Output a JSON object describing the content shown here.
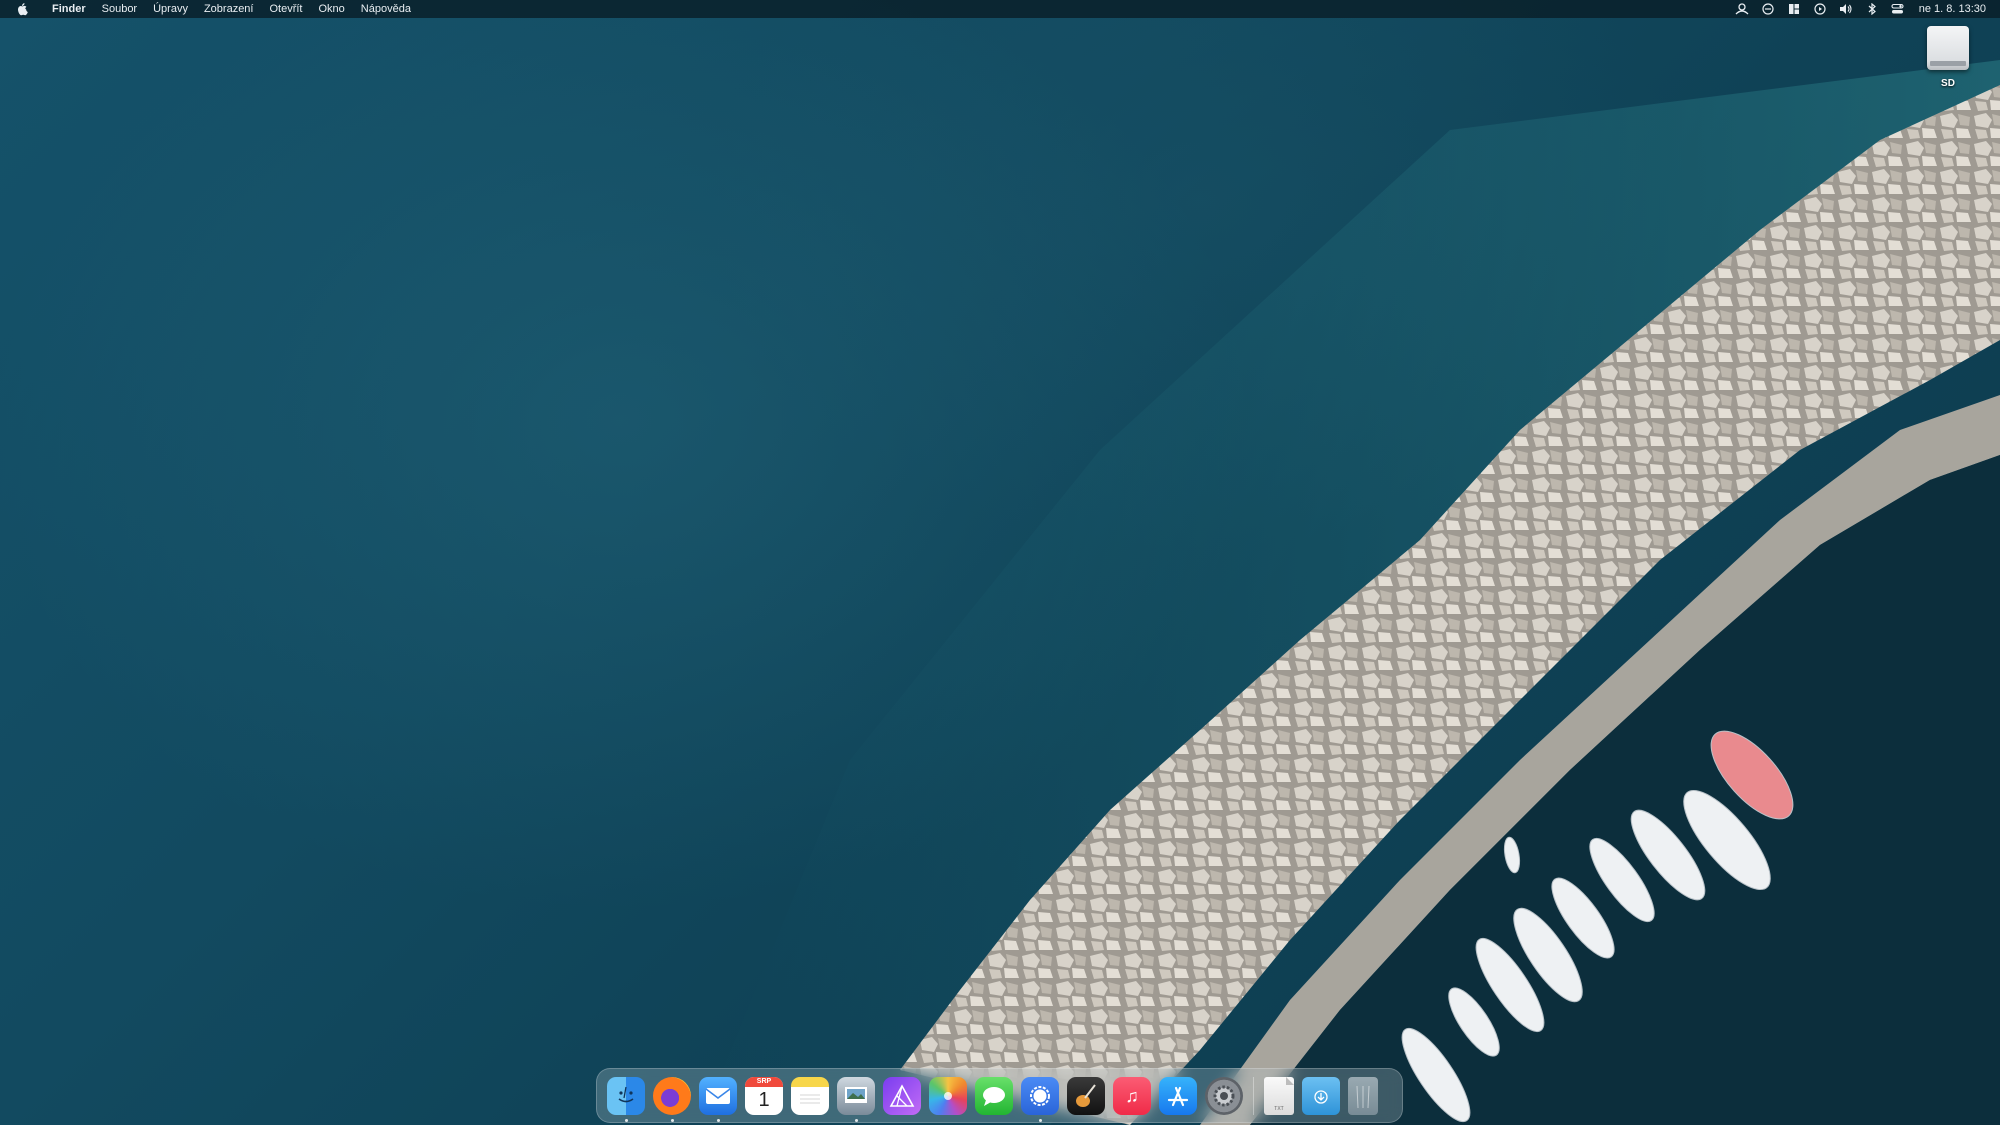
{
  "menubar": {
    "app_name": "Finder",
    "menus": [
      "Soubor",
      "Úpravy",
      "Zobrazení",
      "Otevřít",
      "Okno",
      "Nápověda"
    ],
    "status_icons": [
      "astronaut-icon",
      "minus-circle-icon",
      "window-layout-icon",
      "play-circle-icon",
      "volume-icon",
      "bluetooth-icon",
      "control-center-icon"
    ],
    "clock": "ne 1. 8.  13:30"
  },
  "desktop": {
    "drive_label": "SD"
  },
  "dock": {
    "apps": [
      {
        "name": "Finder",
        "icon": "finder-icon",
        "running": true
      },
      {
        "name": "Firefox",
        "icon": "firefox-icon",
        "running": true
      },
      {
        "name": "Mail",
        "icon": "mail-icon",
        "running": true
      },
      {
        "name": "Kalendář",
        "icon": "calendar-icon",
        "running": false,
        "month": "SRP",
        "day": "1"
      },
      {
        "name": "Poznámky",
        "icon": "notes-icon",
        "running": false
      },
      {
        "name": "Náhled",
        "icon": "preview-icon",
        "running": true
      },
      {
        "name": "Affinity",
        "icon": "affinity-icon",
        "running": false
      },
      {
        "name": "Fotky",
        "icon": "photos-icon",
        "running": false
      },
      {
        "name": "Zprávy",
        "icon": "messages-icon",
        "running": false
      },
      {
        "name": "Signal",
        "icon": "signal-icon",
        "running": true
      },
      {
        "name": "GarageBand",
        "icon": "garageband-icon",
        "running": false
      },
      {
        "name": "Hudba",
        "icon": "music-icon",
        "running": false
      },
      {
        "name": "App Store",
        "icon": "appstore-icon",
        "running": false
      },
      {
        "name": "Nastavení",
        "icon": "settings-icon",
        "running": false
      }
    ],
    "others": [
      {
        "icon": "text-document-icon",
        "badge": "TXT"
      },
      {
        "icon": "downloads-folder-icon"
      },
      {
        "icon": "trash-icon"
      }
    ]
  },
  "colors": {
    "sea": "#124a60",
    "menubar": "#0a1e28",
    "rocks": "#c9c4bb",
    "pier": "#a8a59d"
  }
}
